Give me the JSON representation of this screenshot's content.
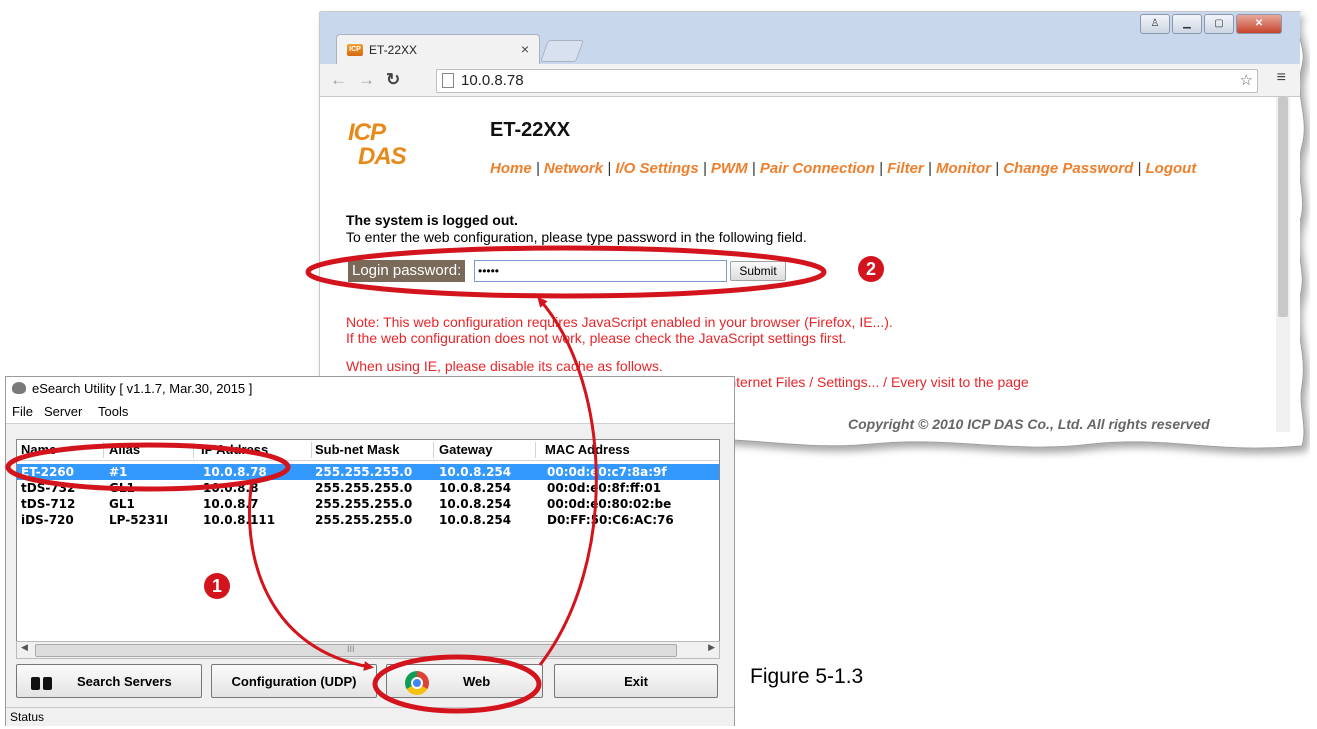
{
  "browser": {
    "tab_title": "ET-22XX",
    "tab_close": "×",
    "url": "10.0.8.78",
    "page": {
      "logo_line1": "ICP",
      "logo_line2": "DAS",
      "model": "ET-22XX",
      "menu": [
        "Home",
        "Network",
        "I/O Settings",
        "PWM",
        "Pair Connection",
        "Filter",
        "Monitor",
        "Change Password",
        "Logout"
      ],
      "logged_out": "The system is logged out.",
      "instruction": "To enter the web configuration, please type password in the following field.",
      "login_label": "Login password:",
      "password_value": "•••••",
      "submit_label": "Submit",
      "note1": "Note: This web configuration requires JavaScript enabled in your browser (Firefox, IE...).",
      "note2": "If the web configuration does not work, please check the JavaScript settings first.",
      "ie1": "When using IE, please disable its cache as follows.",
      "ie2": "Menu items: Tools / Internet Options... / General / Temporary Internet Files / Settings... / Every visit to the page",
      "copyright": "Copyright © 2010 ICP DAS Co., Ltd. All rights reserved"
    }
  },
  "esearch": {
    "title": "eSearch Utility [ v1.1.7, Mar.30, 2015 ]",
    "menu": [
      "File",
      "Server",
      "Tools"
    ],
    "columns": [
      "Name",
      "Alias",
      "IP Address",
      "Sub-net Mask",
      "Gateway",
      "MAC Address"
    ],
    "rows": [
      [
        "ET-2260",
        "#1",
        "10.0.8.78",
        "255.255.255.0",
        "10.0.8.254",
        "00:0d:e0:c7:8a:9f"
      ],
      [
        "tDS-732",
        "GL1",
        "10.0.8.8",
        "255.255.255.0",
        "10.0.8.254",
        "00:0d:e0:8f:ff:01"
      ],
      [
        "tDS-712",
        "GL1",
        "10.0.8.7",
        "255.255.255.0",
        "10.0.8.254",
        "00:0d:e0:80:02:be"
      ],
      [
        "iDS-720",
        "LP-5231I",
        "10.0.8.111",
        "255.255.255.0",
        "10.0.8.254",
        "D0:FF:50:C6:AC:76"
      ]
    ],
    "selected_row": 0,
    "scroll_center": "III",
    "buttons": {
      "search": "Search Servers",
      "config": "Configuration (UDP)",
      "web": "Web",
      "exit": "Exit"
    },
    "status": "Status"
  },
  "annotations": {
    "callout1": "1",
    "callout2": "2",
    "color": "#d3141c"
  },
  "figure_caption": "Figure 5-1.3"
}
